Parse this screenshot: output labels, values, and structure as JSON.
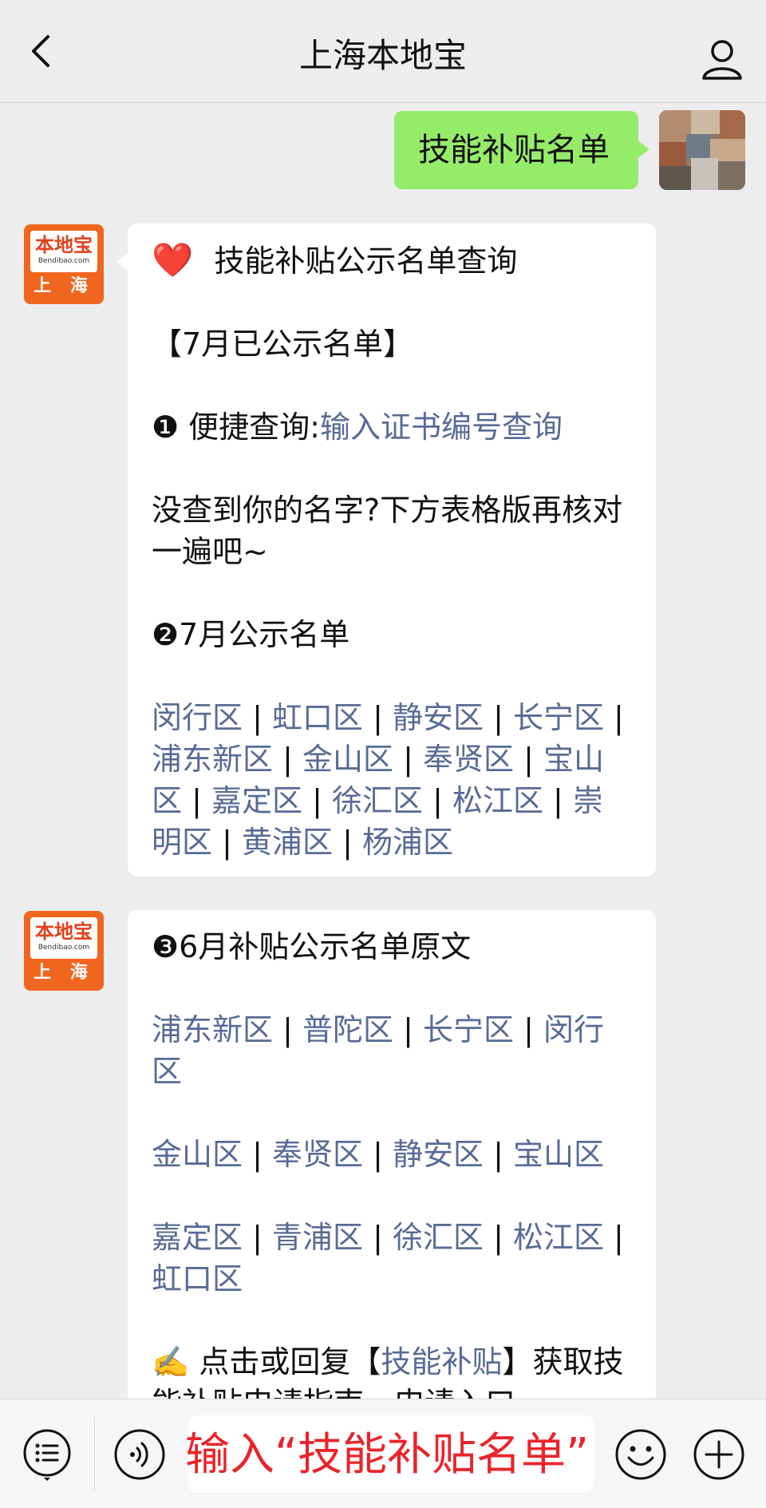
{
  "header": {
    "title": "上海本地宝",
    "back_icon": "chevron-left-icon",
    "profile_icon": "person-icon"
  },
  "user_message": {
    "text": "技能补贴名单"
  },
  "bot_avatar": {
    "brand": "本地宝",
    "site": "Bendibao.com",
    "city": "上 海"
  },
  "message1": {
    "heart": "❤️",
    "title": "技能补贴公示名单查询",
    "section1": "【7月已公示名单】",
    "quick_prefix": "❶ 便捷查询:",
    "quick_link": "输入证书编号查询",
    "not_found": "没查到你的名字?下方表格版再核对一遍吧~",
    "section2": "❷7月公示名单",
    "districts": [
      "闵行区",
      "虹口区",
      "静安区",
      "长宁区",
      "浦东新区",
      "金山区",
      "奉贤区",
      "宝山区",
      "嘉定区",
      "徐汇区",
      "松江区",
      "崇明区",
      "黄浦区",
      "杨浦区"
    ]
  },
  "message2": {
    "section3": "❸6月补贴公示名单原文",
    "group1": [
      "浦东新区",
      "普陀区",
      "长宁区",
      "闵行区"
    ],
    "group2": [
      "金山区",
      "奉贤区",
      "静安区",
      "宝山区"
    ],
    "group3": [
      "嘉定区",
      "青浦区",
      "徐汇区",
      "松江区",
      "虹口区"
    ],
    "tip_emoji": "✍️",
    "tip_before": " 点击或回复【",
    "tip_link": "技能补贴",
    "tip_after": "】获取技能补贴申请指南、申请入口"
  },
  "bottom_bar": {
    "menu_icon": "menu-list-icon",
    "voice_icon": "voice-icon",
    "emoji_icon": "smiley-icon",
    "plus_icon": "plus-icon",
    "input_overlay": "输入“技能补贴名单”"
  }
}
